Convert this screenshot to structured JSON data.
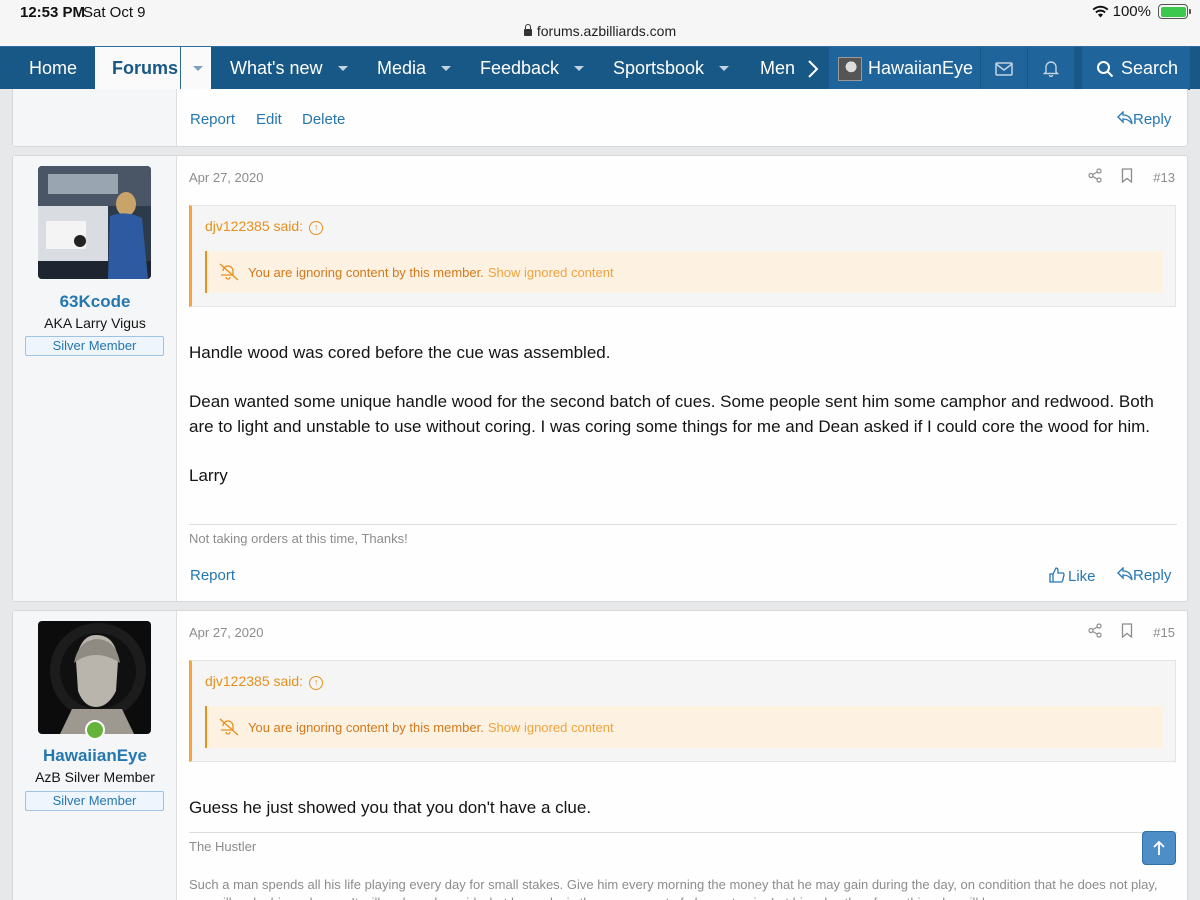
{
  "status_bar": {
    "time": "12:53 PM",
    "date": "Sat Oct 9",
    "url": "forums.azbilliards.com",
    "battery": "100%"
  },
  "nav": {
    "items": [
      {
        "label": "Home"
      },
      {
        "label": "Forums",
        "active": true
      },
      {
        "label": "What's new"
      },
      {
        "label": "Media"
      },
      {
        "label": "Feedback"
      },
      {
        "label": "Sportsbook"
      },
      {
        "label": "Men"
      }
    ],
    "username": "HawaiianEye",
    "search_label": "Search"
  },
  "prev_post_actions": {
    "report": "Report",
    "edit": "Edit",
    "delete": "Delete",
    "reply": "Reply"
  },
  "posts": [
    {
      "username": "63Kcode",
      "user_title": "AKA Larry Vigus",
      "banner": "Silver Member",
      "date": "Apr 27, 2020",
      "number": "#13",
      "quote_author": "djv122385 said:",
      "ignored_text": "You are ignoring content by this member.",
      "ignored_link": "Show ignored content",
      "paragraphs": [
        "Handle wood was cored before the cue was assembled.",
        "Dean wanted some unique handle wood for the second batch of cues. Some people sent him some camphor and redwood. Both are to light and unstable to use without coring. I was coring some things for me and Dean asked if I could core the wood for him.",
        "Larry"
      ],
      "signature": "Not taking orders at this time, Thanks!",
      "actions": {
        "report": "Report",
        "like": "Like",
        "reply": "Reply"
      }
    },
    {
      "username": "HawaiianEye",
      "user_title": "AzB Silver Member",
      "banner": "Silver Member",
      "date": "Apr 27, 2020",
      "number": "#15",
      "quote_author": "djv122385 said:",
      "ignored_text": "You are ignoring content by this member.",
      "ignored_link": "Show ignored content",
      "paragraphs": [
        "Guess he just showed you that you don't have a clue."
      ],
      "signature": "The Hustler",
      "signature_text": "Such a man spends all his life playing every day for small stakes. Give him every morning the money that he may gain during the day, on condition that he does not play, you will make him unhappy. It will perhaps be said what he seeks is the amusement of play, not gain. Let him play then for nothing, he will lose"
    }
  ],
  "colors": {
    "nav_bg": "#185886",
    "link": "#2577b1",
    "quote_accent": "#f7a43a"
  }
}
